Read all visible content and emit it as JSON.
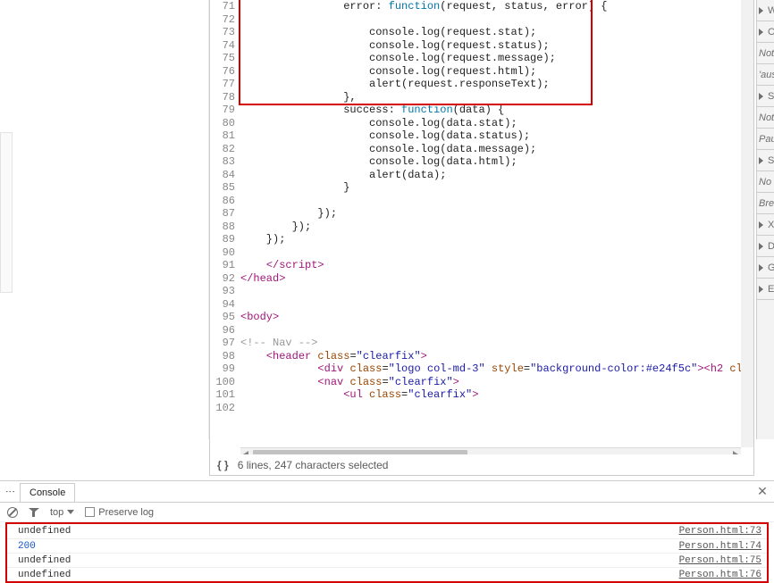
{
  "lines": [
    {
      "n": 71,
      "tokens": [
        {
          "t": "                error: ",
          "c": "punc"
        },
        {
          "t": "function",
          "c": "fn"
        },
        {
          "t": "(request, status, error) {",
          "c": "punc"
        }
      ]
    },
    {
      "n": 72,
      "tokens": []
    },
    {
      "n": 73,
      "tokens": [
        {
          "t": "                    console.log(request.stat);",
          "c": "punc"
        }
      ]
    },
    {
      "n": 74,
      "tokens": [
        {
          "t": "                    console.log(request.status);",
          "c": "punc"
        }
      ]
    },
    {
      "n": 75,
      "tokens": [
        {
          "t": "                    console.log(request.message);",
          "c": "punc"
        }
      ]
    },
    {
      "n": 76,
      "tokens": [
        {
          "t": "                    console.log(request.html);",
          "c": "punc"
        }
      ]
    },
    {
      "n": 77,
      "tokens": [
        {
          "t": "                    alert(request.responseText);",
          "c": "punc"
        }
      ]
    },
    {
      "n": 78,
      "tokens": [
        {
          "t": "                },",
          "c": "punc"
        }
      ]
    },
    {
      "n": 79,
      "tokens": [
        {
          "t": "                success: ",
          "c": "punc"
        },
        {
          "t": "function",
          "c": "fn"
        },
        {
          "t": "(data) {",
          "c": "punc"
        }
      ]
    },
    {
      "n": 80,
      "tokens": [
        {
          "t": "                    console.log(data.stat);",
          "c": "punc"
        }
      ]
    },
    {
      "n": 81,
      "tokens": [
        {
          "t": "                    console.log(data.status);",
          "c": "punc"
        }
      ]
    },
    {
      "n": 82,
      "tokens": [
        {
          "t": "                    console.log(data.message);",
          "c": "punc"
        }
      ]
    },
    {
      "n": 83,
      "tokens": [
        {
          "t": "                    console.log(data.html);",
          "c": "punc"
        }
      ]
    },
    {
      "n": 84,
      "tokens": [
        {
          "t": "                    alert(data);",
          "c": "punc"
        }
      ]
    },
    {
      "n": 85,
      "tokens": [
        {
          "t": "                }",
          "c": "punc"
        }
      ]
    },
    {
      "n": 86,
      "tokens": []
    },
    {
      "n": 87,
      "tokens": [
        {
          "t": "            });",
          "c": "punc"
        }
      ]
    },
    {
      "n": 88,
      "tokens": [
        {
          "t": "        });",
          "c": "punc"
        }
      ]
    },
    {
      "n": 89,
      "tokens": [
        {
          "t": "    });",
          "c": "punc"
        }
      ]
    },
    {
      "n": 90,
      "tokens": []
    },
    {
      "n": 91,
      "tokens": [
        {
          "t": "    ",
          "c": "punc"
        },
        {
          "t": "</script",
          "c": "tag"
        },
        {
          "t": ">",
          "c": "tag"
        }
      ]
    },
    {
      "n": 92,
      "tokens": [
        {
          "t": "</head",
          "c": "tag"
        },
        {
          "t": ">",
          "c": "tag"
        }
      ]
    },
    {
      "n": 93,
      "tokens": []
    },
    {
      "n": 94,
      "tokens": []
    },
    {
      "n": 95,
      "tokens": [
        {
          "t": "<body",
          "c": "tag"
        },
        {
          "t": ">",
          "c": "tag"
        }
      ]
    },
    {
      "n": 96,
      "tokens": []
    },
    {
      "n": 97,
      "tokens": [
        {
          "t": "<!-- Nav -->",
          "c": "cmt"
        }
      ]
    },
    {
      "n": 98,
      "tokens": [
        {
          "t": "    ",
          "c": "punc"
        },
        {
          "t": "<header ",
          "c": "tag"
        },
        {
          "t": "class",
          "c": "attr"
        },
        {
          "t": "=",
          "c": "punc"
        },
        {
          "t": "\"clearfix\"",
          "c": "str"
        },
        {
          "t": ">",
          "c": "tag"
        }
      ]
    },
    {
      "n": 99,
      "tokens": [
        {
          "t": "            ",
          "c": "punc"
        },
        {
          "t": "<div ",
          "c": "tag"
        },
        {
          "t": "class",
          "c": "attr"
        },
        {
          "t": "=",
          "c": "punc"
        },
        {
          "t": "\"logo col-md-3\"",
          "c": "str"
        },
        {
          "t": " ",
          "c": "punc"
        },
        {
          "t": "style",
          "c": "attr"
        },
        {
          "t": "=",
          "c": "punc"
        },
        {
          "t": "\"background-color:#e24f5c\"",
          "c": "str"
        },
        {
          "t": ">",
          "c": "tag"
        },
        {
          "t": "<h2 ",
          "c": "tag"
        },
        {
          "t": "class",
          "c": "attr"
        },
        {
          "t": "=",
          "c": "punc"
        },
        {
          "t": "\"",
          "c": "str"
        }
      ]
    },
    {
      "n": 100,
      "tokens": [
        {
          "t": "            ",
          "c": "punc"
        },
        {
          "t": "<nav ",
          "c": "tag"
        },
        {
          "t": "class",
          "c": "attr"
        },
        {
          "t": "=",
          "c": "punc"
        },
        {
          "t": "\"clearfix\"",
          "c": "str"
        },
        {
          "t": ">",
          "c": "tag"
        }
      ]
    },
    {
      "n": 101,
      "tokens": [
        {
          "t": "                ",
          "c": "punc"
        },
        {
          "t": "<ul ",
          "c": "tag"
        },
        {
          "t": "class",
          "c": "attr"
        },
        {
          "t": "=",
          "c": "punc"
        },
        {
          "t": "\"clearfix\"",
          "c": "str"
        },
        {
          "t": ">",
          "c": "tag"
        }
      ]
    },
    {
      "n": 102,
      "tokens": []
    }
  ],
  "status": {
    "text": "6 lines, 247 characters selected"
  },
  "rail": [
    {
      "label": "W"
    },
    {
      "label": "C"
    },
    {
      "text": "Not"
    },
    {
      "text": "'ause"
    },
    {
      "label": "S"
    },
    {
      "text": "Not"
    },
    {
      "text": "Pau"
    },
    {
      "label": "S"
    },
    {
      "text": "No "
    },
    {
      "text": "Bre"
    },
    {
      "label": "X"
    },
    {
      "label": "D"
    },
    {
      "label": "G"
    },
    {
      "label": "E"
    }
  ],
  "console": {
    "tab": "Console",
    "context": "top",
    "preserve_label": "Preserve log",
    "logs": [
      {
        "msg": "undefined",
        "src": "Person.html:73",
        "cls": ""
      },
      {
        "msg": "200",
        "src": "Person.html:74",
        "cls": "log-blue"
      },
      {
        "msg": "undefined",
        "src": "Person.html:75",
        "cls": ""
      },
      {
        "msg": "undefined",
        "src": "Person.html:76",
        "cls": ""
      }
    ]
  }
}
